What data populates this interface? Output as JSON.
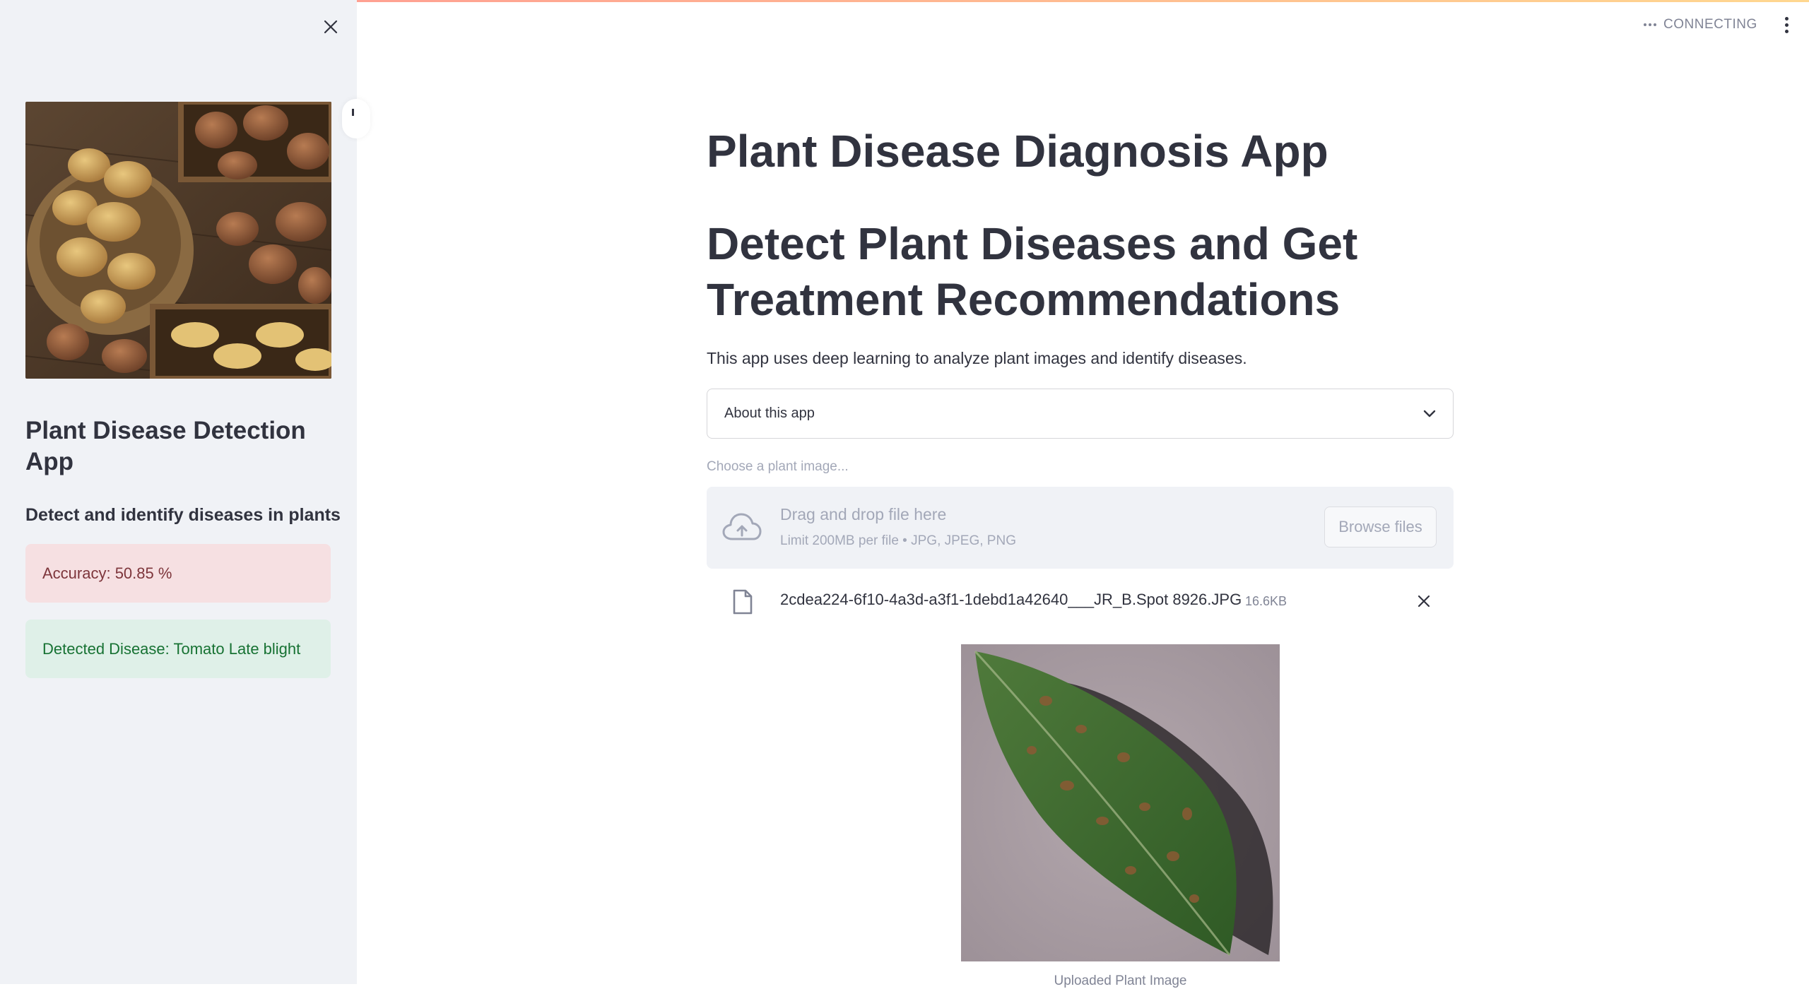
{
  "sidebar": {
    "title": "Plant Disease Detection App",
    "subtitle": "Detect and identify diseases in plants",
    "accuracy_text": "Accuracy: 50.85 %",
    "detected_text": "Detected Disease: Tomato Late blight"
  },
  "header": {
    "status": "CONNECTING"
  },
  "main": {
    "title": "Plant Disease Diagnosis App",
    "heading": "Detect Plant Diseases and Get Treatment Recommendations",
    "description": "This app uses deep learning to analyze plant images and identify diseases.",
    "expander_label": "About this app",
    "uploader": {
      "label": "Choose a plant image...",
      "drop_title": "Drag and drop file here",
      "limit": "Limit 200MB per file • JPG, JPEG, PNG",
      "browse_label": "Browse files"
    },
    "file": {
      "name": "2cdea224-6f10-4a3d-a3f1-1debd1a42640___JR_B.Spot 8926.JPG",
      "size": "16.6KB"
    },
    "image_caption": "Uploaded Plant Image"
  },
  "colors": {
    "sidebar_bg": "#f0f2f6",
    "error_bg": "#f6e0e2",
    "error_text": "#7d353b",
    "success_bg": "#dff0e8",
    "success_text": "#177233",
    "text": "#31333f"
  },
  "icons": [
    "close-icon",
    "sidebar-collapse-icon",
    "status-dots-icon",
    "kebab-menu-icon",
    "chevron-down-icon",
    "cloud-upload-icon",
    "file-icon",
    "remove-icon"
  ]
}
